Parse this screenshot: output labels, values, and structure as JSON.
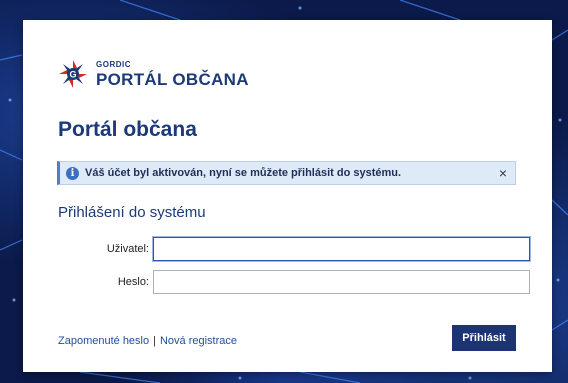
{
  "logo": {
    "small_text": "GORDIC",
    "big_text": "PORTÁL OBČANA"
  },
  "page_title": "Portál občana",
  "alert": {
    "icon": "info-icon",
    "text": "Váš účet byl aktivován, nyní se můžete přihlásit do systému.",
    "close": "×"
  },
  "login": {
    "section_title": "Přihlášení do systému",
    "username_label": "Uživatel:",
    "username_value": "",
    "password_label": "Heslo:",
    "password_value": "",
    "submit_label": "Přihlásit"
  },
  "links": {
    "forgot_password": "Zapomenuté heslo",
    "separator": "|",
    "new_registration": "Nová registrace"
  },
  "colors": {
    "brand": "#1c3a7a",
    "button": "#1d3474",
    "alert_bg": "#dfeaf8",
    "background": "#0b1a4a"
  }
}
